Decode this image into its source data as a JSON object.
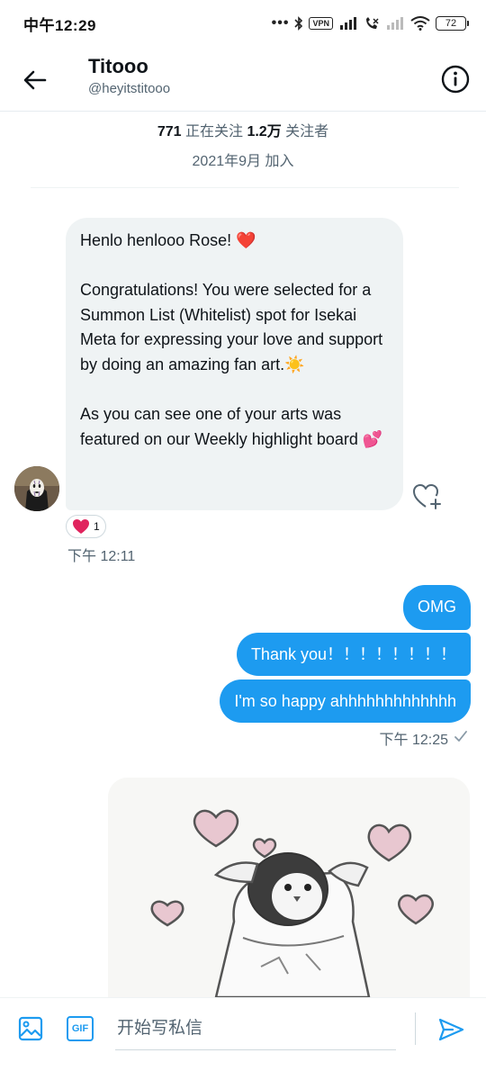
{
  "status_bar": {
    "time": "中午12:29",
    "dots": "•••",
    "vpn": "VPN",
    "battery": "72"
  },
  "header": {
    "title": "Titooo",
    "handle": "@heyitstitooo",
    "back_icon": "arrow-left-icon",
    "info_icon": "info-circle-icon"
  },
  "profile": {
    "following_count": "771",
    "following_label": "正在关注",
    "followers_count": "1.2万",
    "followers_label": "关注者",
    "joined": "2021年9月 加入"
  },
  "received": {
    "greeting": "Henlo henlooo Rose! ",
    "greeting_emoji": "❤️",
    "paragraph_1": "Congratulations! You were selected for a Summon List (Whitelist) spot for Isekai Meta for expressing your love and support by doing an amazing fan art.",
    "paragraph_1_emoji": "☀️",
    "paragraph_2": "As you can see one of your arts was featured on our Weekly highlight board ",
    "paragraph_2_emoji": "💕",
    "reaction_emoji": "❤️",
    "reaction_count": "1",
    "time": "下午 12:11"
  },
  "sent": {
    "messages": [
      "OMG",
      "Thank you！！！！！！！！",
      "I'm so happy ahhhhhhhhhhhhh"
    ],
    "time": "下午 12:25"
  },
  "composer": {
    "placeholder": "开始写私信",
    "gif_label": "GIF"
  },
  "colors": {
    "accent": "#1d9bf0",
    "bubble_received": "#eff3f4",
    "secondary_text": "#536471"
  }
}
